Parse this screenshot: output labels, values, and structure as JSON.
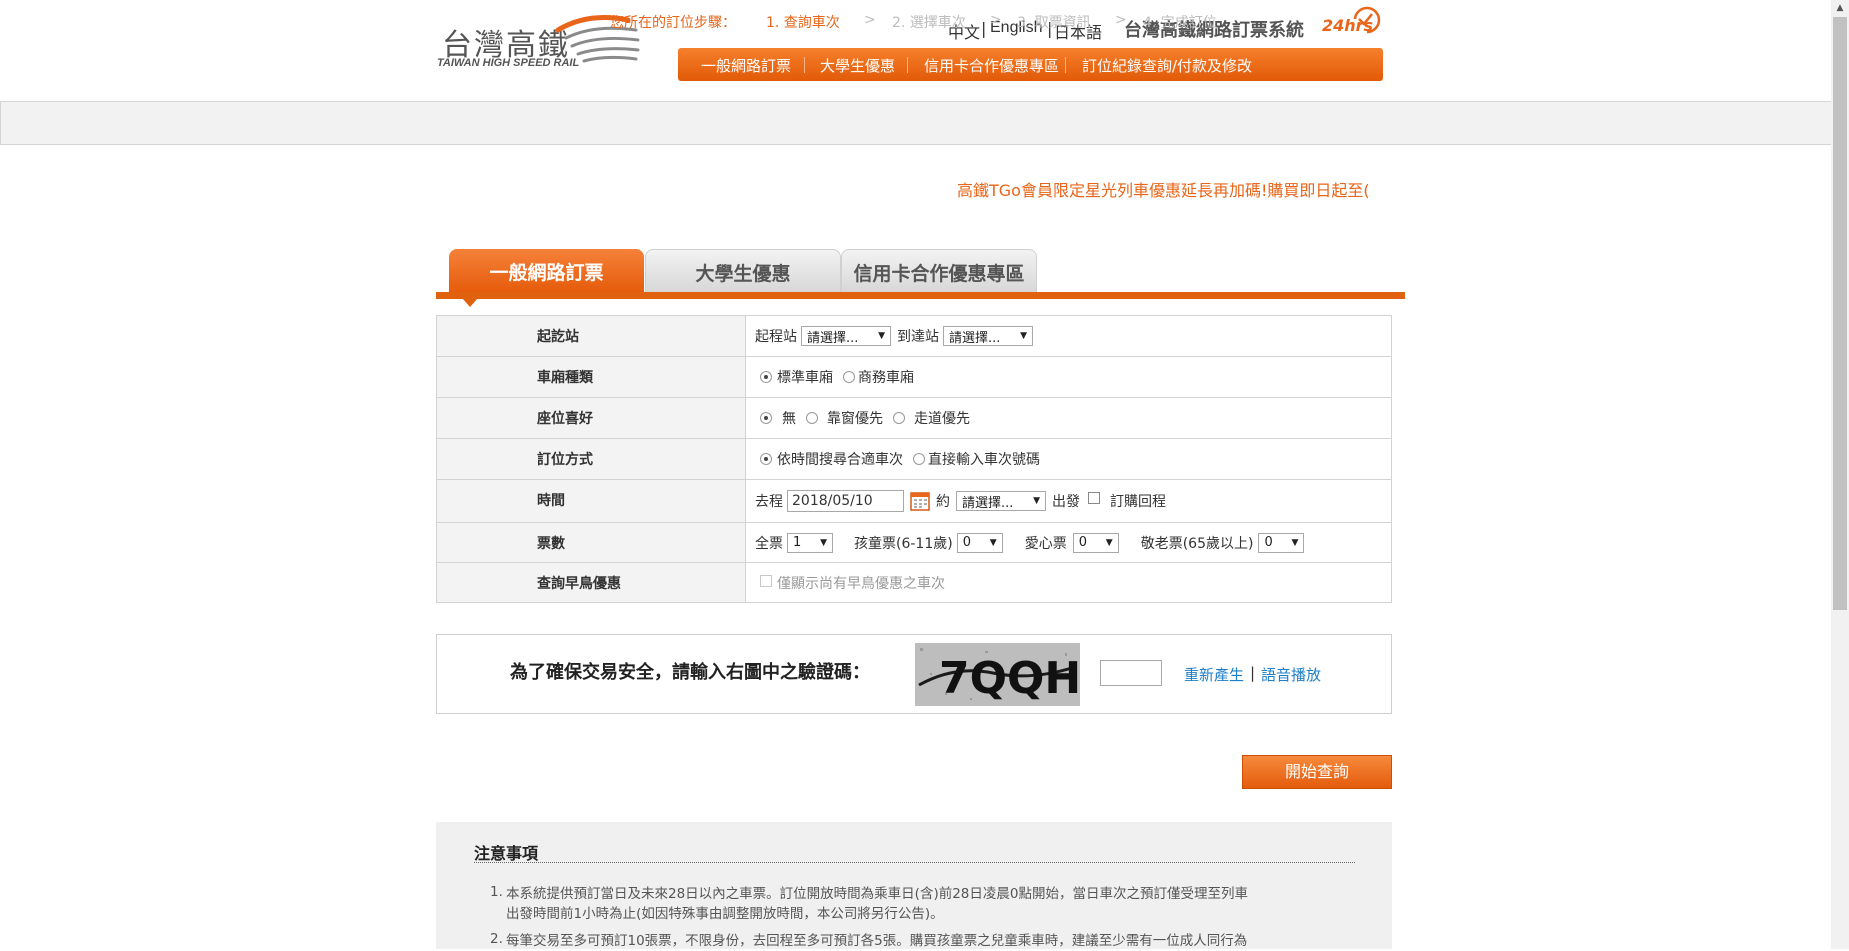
{
  "header": {
    "logo_cn": "台灣高鐵",
    "logo_en": "TAIWAN HIGH SPEED RAIL",
    "languages": [
      "中文",
      "English",
      "日本語"
    ],
    "system_title": "台灣高鐵網路訂票系統",
    "hours_badge": "24hrs",
    "nav": [
      "一般網路訂票",
      "大學生優惠",
      "信用卡合作優惠專區",
      "訂位紀錄查詢/付款及修改"
    ]
  },
  "steps": {
    "label": "您所在的訂位步驟：",
    "items": [
      "1. 查詢車次",
      "2. 選擇車次",
      "3. 取票資訊",
      "4. 完成訂位"
    ],
    "separator": ">"
  },
  "marquee": "高鐵TGo會員限定星光列車優惠延長再加碼!購買即日起至(",
  "tabs": [
    "一般網路訂票",
    "大學生優惠",
    "信用卡合作優惠專區"
  ],
  "form": {
    "station": {
      "label": "起訖站",
      "from_label": "起程站",
      "from_value": "請選擇...",
      "to_label": "到達站",
      "to_value": "請選擇..."
    },
    "car_type": {
      "label": "車廂種類",
      "options": [
        "標準車廂",
        "商務車廂"
      ],
      "selected": "標準車廂"
    },
    "seat_pref": {
      "label": "座位喜好",
      "options": [
        "無",
        "靠窗優先",
        "走道優先"
      ],
      "selected": "無"
    },
    "booking_method": {
      "label": "訂位方式",
      "options": [
        "依時間搜尋合適車次",
        "直接輸入車次號碼"
      ],
      "selected": "依時間搜尋合適車次"
    },
    "time": {
      "label": "時間",
      "go_label": "去程",
      "date": "2018/05/10",
      "about_label": "約",
      "time_value": "請選擇...",
      "depart_label": "出發",
      "return_label": "訂購回程"
    },
    "tickets": {
      "label": "票數",
      "full_label": "全票",
      "full_value": "1",
      "child_label": "孩童票(6-11歲)",
      "child_value": "0",
      "disabled_label": "愛心票",
      "disabled_value": "0",
      "senior_label": "敬老票(65歲以上)",
      "senior_value": "0"
    },
    "early_bird": {
      "label": "查詢早鳥優惠",
      "option": "僅顯示尚有早鳥優惠之車次"
    }
  },
  "captcha": {
    "prompt": "為了確保交易安全，請輸入右圖中之驗證碼：",
    "image_text": "7QQH",
    "regenerate": "重新產生",
    "audio": "語音播放",
    "separator": "|"
  },
  "submit_label": "開始查詢",
  "notes": {
    "title": "注意事項",
    "items": [
      {
        "num": "1.",
        "line1": "本系統提供預訂當日及未來28日以內之車票。訂位開放時間為乘車日(含)前28日凌晨0點開始，當日車次之預訂僅受理至列車",
        "line2": "出發時間前1小時為止(如因特殊事由調整開放時間，本公司將另行公告)。"
      },
      {
        "num": "2.",
        "line1": "每筆交易至多可預訂10張票，不限身份，去回程至多可預訂各5張。購買孩童票之兒童乘車時，建議至少需有一位成人同行為"
      }
    ]
  },
  "colors": {
    "accent": "#e8651a",
    "nav_bg": "#ee6e16",
    "link": "#1f7fc7"
  }
}
